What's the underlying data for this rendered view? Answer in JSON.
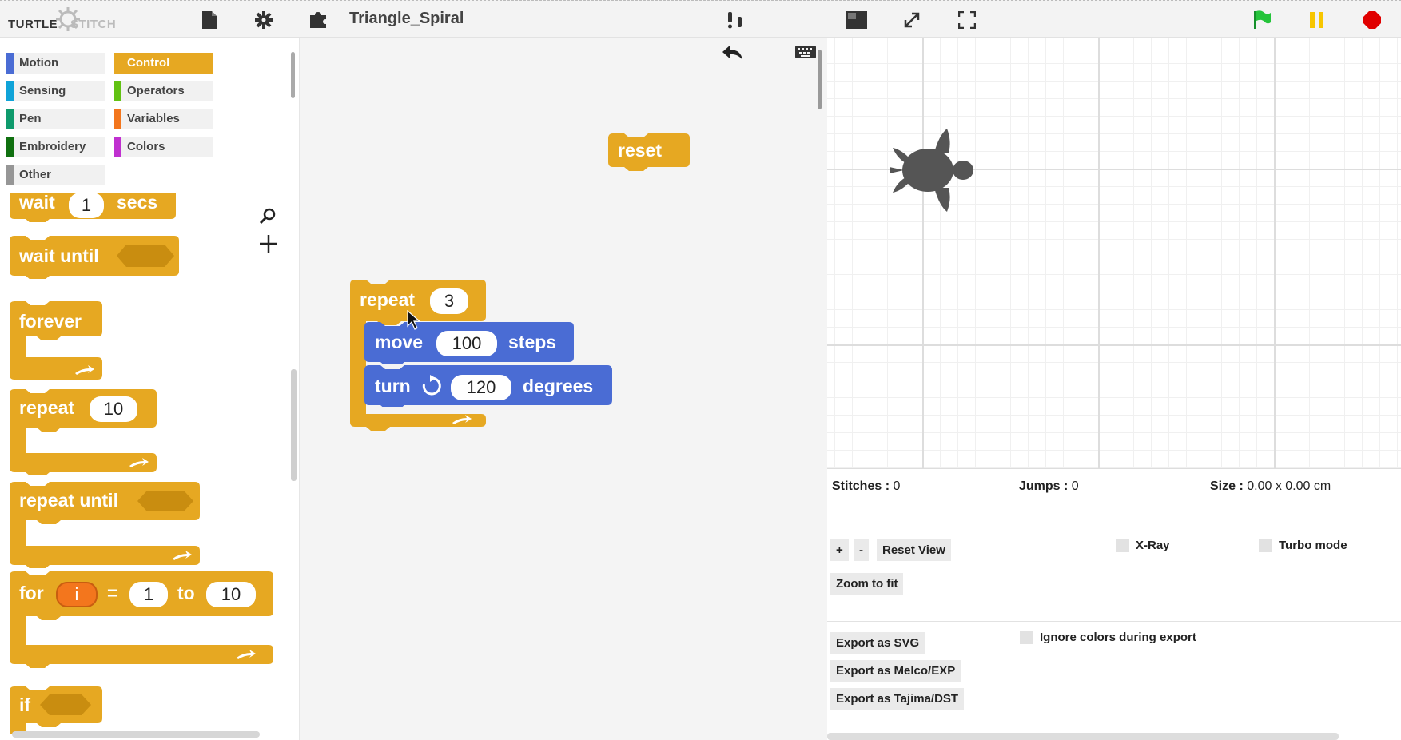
{
  "header": {
    "logo_turtle": "TURTLE",
    "logo_stitch": "STITCH",
    "project_title": "Triangle_Spiral",
    "icons": [
      "file-icon",
      "gear-icon",
      "puzzle-icon",
      "cloud-icon",
      "stage-size-icon",
      "expand-icon",
      "fullscreen-icon",
      "green-flag-icon",
      "pause-icon",
      "stop-icon"
    ]
  },
  "categories": [
    {
      "label": "Motion",
      "color": "#4a6cd4"
    },
    {
      "label": "Control",
      "color": "#e6a822"
    },
    {
      "label": "Sensing",
      "color": "#0fa3d8"
    },
    {
      "label": "Operators",
      "color": "#62c213"
    },
    {
      "label": "Pen",
      "color": "#0e9a6c"
    },
    {
      "label": "Variables",
      "color": "#f3761d"
    },
    {
      "label": "Embroidery",
      "color": "#107010"
    },
    {
      "label": "Colors",
      "color": "#c030d0"
    },
    {
      "label": "Other",
      "color": "#969696"
    }
  ],
  "active_category": "Control",
  "palette_blocks": {
    "wait": {
      "label": "wait",
      "value": "1",
      "suffix": "secs"
    },
    "wait_until": {
      "label": "wait until"
    },
    "forever": {
      "label": "forever"
    },
    "repeat": {
      "label": "repeat",
      "value": "10"
    },
    "repeat_until": {
      "label": "repeat until"
    },
    "for": {
      "label": "for",
      "var": "i",
      "eq": "=",
      "from": "1",
      "to_label": "to",
      "to": "10"
    },
    "if": {
      "label": "if"
    }
  },
  "script_blocks": {
    "reset": {
      "label": "reset"
    },
    "repeat": {
      "label": "repeat",
      "value": "3"
    },
    "move": {
      "label": "move",
      "value": "100",
      "suffix": "steps"
    },
    "turn": {
      "label": "turn",
      "value": "120",
      "suffix": "degrees"
    }
  },
  "stats": {
    "stitches_label": "Stitches :",
    "stitches_value": "0",
    "jumps_label": "Jumps :",
    "jumps_value": "0",
    "size_label": "Size :",
    "size_value": "0.00 x 0.00 cm"
  },
  "controls": {
    "zoom_in": "+",
    "zoom_out": "-",
    "reset_view": "Reset View",
    "zoom_to_fit": "Zoom to fit",
    "xray": "X-Ray",
    "turbo": "Turbo mode",
    "export_svg": "Export as SVG",
    "export_exp": "Export as Melco/EXP",
    "export_dst": "Export as Tajima/DST",
    "ignore_colors": "Ignore colors during export"
  },
  "colors": {
    "control": "#e6a822",
    "control_dark": "#c98d10",
    "motion": "#4a6cd4",
    "motion_dark": "#3a58b8",
    "variable": "#f3761d",
    "turtle": "#555555"
  }
}
